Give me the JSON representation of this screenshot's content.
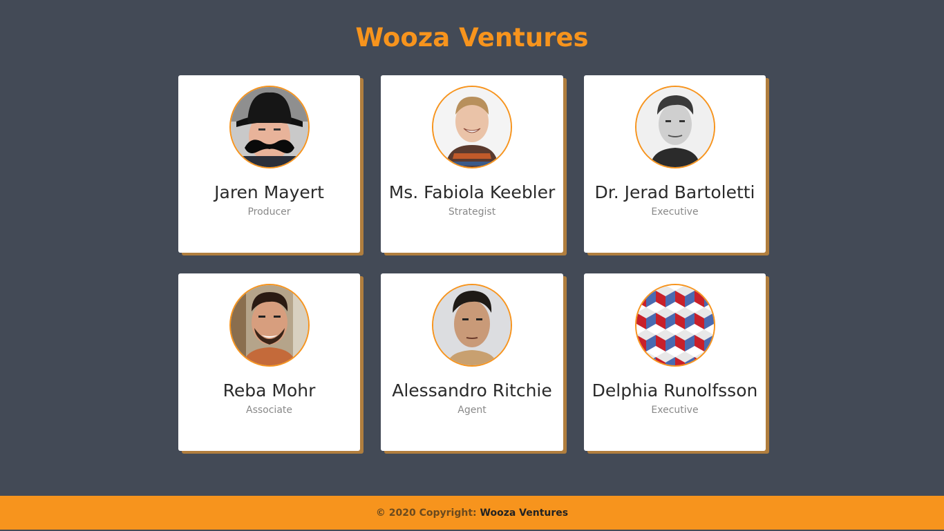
{
  "header": {
    "title": "Wooza Ventures"
  },
  "team": [
    {
      "name": "Jaren Mayert",
      "role": "Producer",
      "avatar_icon": "cowboy-mustache-portrait"
    },
    {
      "name": "Ms. Fabiola Keebler",
      "role": "Strategist",
      "avatar_icon": "smiling-man-portrait"
    },
    {
      "name": "Dr. Jerad Bartoletti",
      "role": "Executive",
      "avatar_icon": "grayscale-man-portrait"
    },
    {
      "name": "Reba Mohr",
      "role": "Associate",
      "avatar_icon": "bearded-man-portrait"
    },
    {
      "name": "Alessandro Ritchie",
      "role": "Agent",
      "avatar_icon": "man-portrait"
    },
    {
      "name": "Delphia Runolfsson",
      "role": "Executive",
      "avatar_icon": "cube-pattern-image"
    }
  ],
  "footer": {
    "prefix": "© 2020 Copyright:",
    "brand": "Wooza Ventures"
  },
  "colors": {
    "background": "#434a56",
    "accent": "#f7941d",
    "card": "#ffffff",
    "card_shadow": "#b07e3e"
  }
}
